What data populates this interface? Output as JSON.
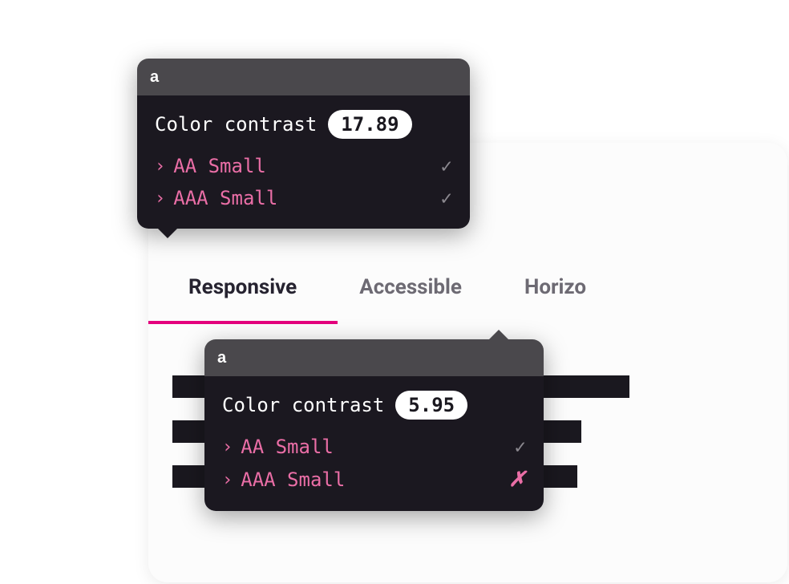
{
  "card": {
    "tabs": [
      {
        "label": "Responsive",
        "active": true
      },
      {
        "label": "Accessible",
        "active": false
      },
      {
        "label": "Horizo",
        "active": false
      }
    ]
  },
  "tooltip1": {
    "header_letter": "a",
    "contrast_label": "Color contrast",
    "contrast_value": "17.89",
    "checks": [
      {
        "label": "AA Small",
        "pass": true
      },
      {
        "label": "AAA Small",
        "pass": true
      }
    ]
  },
  "tooltip2": {
    "header_letter": "a",
    "contrast_label": "Color contrast",
    "contrast_value": "5.95",
    "checks": [
      {
        "label": "AA Small",
        "pass": true
      },
      {
        "label": "AAA Small",
        "pass": false
      }
    ]
  },
  "icons": {
    "chevron": "›",
    "check": "✓",
    "cross": "✗"
  }
}
